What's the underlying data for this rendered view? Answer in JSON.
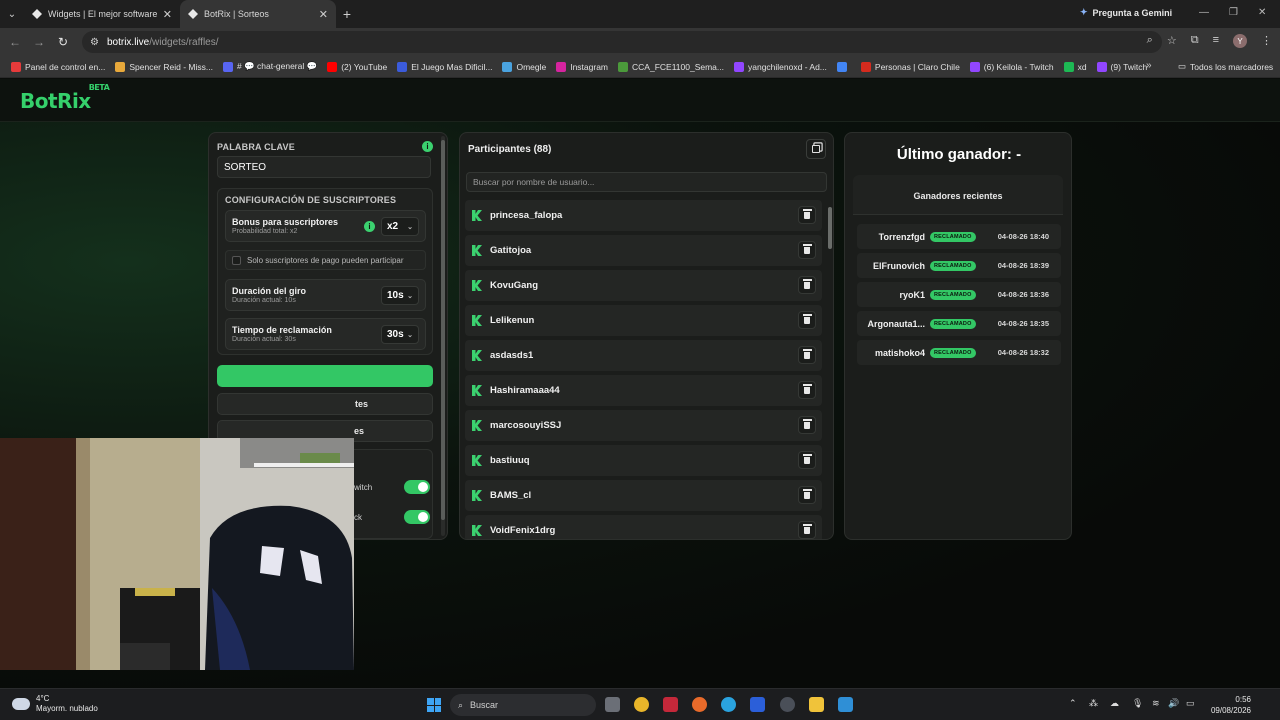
{
  "browser": {
    "tabs": [
      {
        "title": "Widgets | El mejor software pa",
        "close": "✕"
      },
      {
        "title": "BotRix | Sorteos",
        "close": "✕"
      }
    ],
    "new_tab": "+",
    "gemini": "Pregunta a Gemini",
    "url_host": "botrix.live",
    "url_path": "/widgets/raffles/",
    "profile_initial": "Y",
    "bookmarks": [
      {
        "label": "Panel de control en...",
        "color": "#e63b3b"
      },
      {
        "label": "Spencer Reid - Miss...",
        "color": "#e8a93b"
      },
      {
        "label": "# 💬 chat-general 💬",
        "color": "#5865f2"
      },
      {
        "label": "(2) YouTube",
        "color": "#ff0000"
      },
      {
        "label": "El Juego Mas Dificil...",
        "color": "#3b5bdb"
      },
      {
        "label": "Omegle",
        "color": "#4aa3df"
      },
      {
        "label": "Instagram",
        "color": "#d6249f"
      },
      {
        "label": "CCA_FCE1100_Sema...",
        "color": "#4b9a3b"
      },
      {
        "label": "yangchilenoxd - Ad...",
        "color": "#9146ff"
      },
      {
        "label": "",
        "color": "#4285f4"
      },
      {
        "label": "Personas | Claro Chile",
        "color": "#d52b1e"
      },
      {
        "label": "(6) Keilola - Twitch",
        "color": "#9146ff"
      },
      {
        "label": "xd",
        "color": "#1db954"
      },
      {
        "label": "(9) Twitch",
        "color": "#9146ff"
      }
    ],
    "bookmarks_more": "»",
    "all_bookmarks": "Todos los marcadores"
  },
  "app": {
    "logo": "BotRix",
    "logo_sup": "BETA"
  },
  "settings": {
    "keyword_label": "PALABRA CLAVE",
    "keyword_value": "SORTEO",
    "subs_title": "CONFIGURACIÓN DE SUSCRIPTORES",
    "bonus_title": "Bonus para suscriptores",
    "bonus_sub": "Probabilidad total: x2",
    "bonus_value": "x2",
    "paid_only": "Solo suscriptores de pago pueden participar",
    "spin_title": "Duración del giro",
    "spin_sub": "Duración actual: 10s",
    "spin_value": "10s",
    "claim_title": "Tiempo de reclamación",
    "claim_sub": "Duración actual: 30s",
    "claim_value": "30s",
    "btn_participants_partial": "tes",
    "btn_second_partial": "es",
    "toggle1_partial": "witch",
    "toggle2_partial": "ck"
  },
  "participants": {
    "title": "Participantes (88)",
    "search_placeholder": "Buscar por nombre de usuario...",
    "items": [
      "princesa_falopa",
      "Gatitojoa",
      "KovuGang",
      "Lelikenun",
      "asdasds1",
      "Hashiramaaa44",
      "marcosouyiSSJ",
      "bastiuuq",
      "BAMS_cl",
      "VoidFenix1drg"
    ]
  },
  "winners": {
    "last_winner": "Último ganador: -",
    "recent_title": "Ganadores recientes",
    "badge": "RECLAMADO",
    "items": [
      {
        "name": "Torrenzfgd",
        "date": "04-08-26 18:40"
      },
      {
        "name": "ElFrunovich",
        "date": "04-08-26 18:39"
      },
      {
        "name": "ryoK1",
        "date": "04-08-26 18:36"
      },
      {
        "name": "Argonauta1...",
        "date": "04-08-26 18:35"
      },
      {
        "name": "matishoko4",
        "date": "04-08-26 18:32"
      }
    ]
  },
  "taskbar": {
    "temp": "4°C",
    "weather": "Mayorm. nublado",
    "search": "Buscar",
    "time": "0:56",
    "date": "09/08/2026"
  }
}
